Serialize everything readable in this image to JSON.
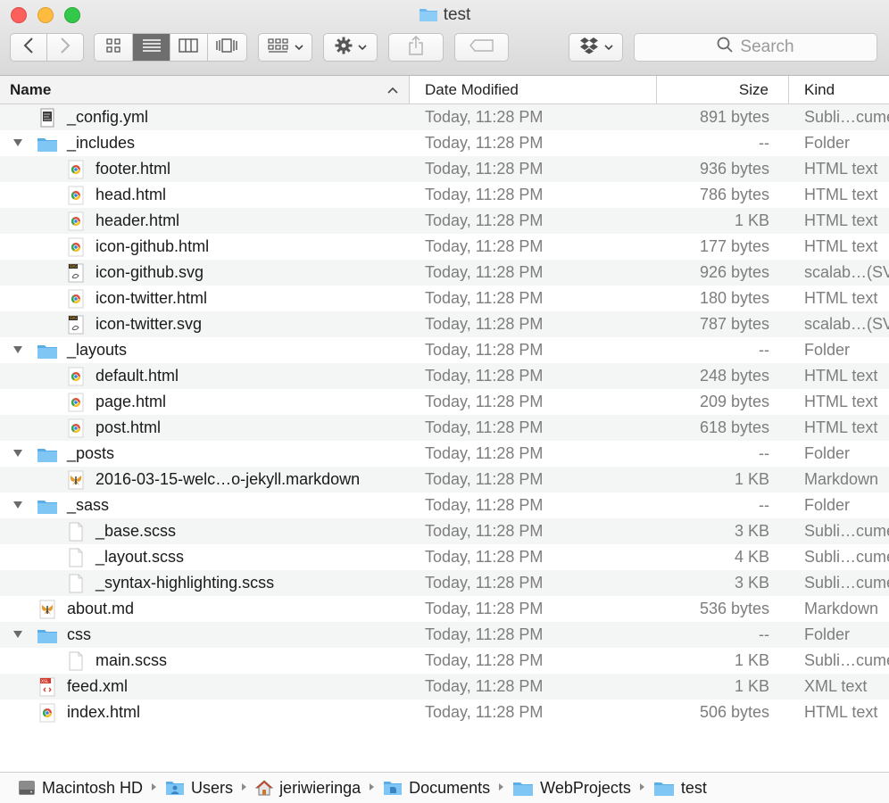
{
  "window": {
    "title": "test"
  },
  "toolbar": {
    "search_placeholder": "Search",
    "back_icon": "chevron-left-icon",
    "forward_icon": "chevron-right-icon"
  },
  "columns": {
    "name": "Name",
    "date": "Date Modified",
    "size": "Size",
    "kind": "Kind"
  },
  "rows": [
    {
      "name": "_config.yml",
      "date": "Today, 11:28 PM",
      "size": "891 bytes",
      "kind": "Subli…cument",
      "icon": "yml-file-icon",
      "level": 0,
      "folder": false
    },
    {
      "name": "_includes",
      "date": "Today, 11:28 PM",
      "size": "--",
      "kind": "Folder",
      "icon": "folder-icon",
      "level": 0,
      "folder": true
    },
    {
      "name": "footer.html",
      "date": "Today, 11:28 PM",
      "size": "936 bytes",
      "kind": "HTML text",
      "icon": "chrome-html-icon",
      "level": 1,
      "folder": false
    },
    {
      "name": "head.html",
      "date": "Today, 11:28 PM",
      "size": "786 bytes",
      "kind": "HTML text",
      "icon": "chrome-html-icon",
      "level": 1,
      "folder": false
    },
    {
      "name": "header.html",
      "date": "Today, 11:28 PM",
      "size": "1 KB",
      "kind": "HTML text",
      "icon": "chrome-html-icon",
      "level": 1,
      "folder": false
    },
    {
      "name": "icon-github.html",
      "date": "Today, 11:28 PM",
      "size": "177 bytes",
      "kind": "HTML text",
      "icon": "chrome-html-icon",
      "level": 1,
      "folder": false
    },
    {
      "name": "icon-github.svg",
      "date": "Today, 11:28 PM",
      "size": "926 bytes",
      "kind": "scalab…(SVG)",
      "icon": "svg-file-icon",
      "level": 1,
      "folder": false
    },
    {
      "name": "icon-twitter.html",
      "date": "Today, 11:28 PM",
      "size": "180 bytes",
      "kind": "HTML text",
      "icon": "chrome-html-icon",
      "level": 1,
      "folder": false
    },
    {
      "name": "icon-twitter.svg",
      "date": "Today, 11:28 PM",
      "size": "787 bytes",
      "kind": "scalab…(SVG)",
      "icon": "svg-file-icon",
      "level": 1,
      "folder": false
    },
    {
      "name": "_layouts",
      "date": "Today, 11:28 PM",
      "size": "--",
      "kind": "Folder",
      "icon": "folder-icon",
      "level": 0,
      "folder": true
    },
    {
      "name": "default.html",
      "date": "Today, 11:28 PM",
      "size": "248 bytes",
      "kind": "HTML text",
      "icon": "chrome-html-icon",
      "level": 1,
      "folder": false
    },
    {
      "name": "page.html",
      "date": "Today, 11:28 PM",
      "size": "209 bytes",
      "kind": "HTML text",
      "icon": "chrome-html-icon",
      "level": 1,
      "folder": false
    },
    {
      "name": "post.html",
      "date": "Today, 11:28 PM",
      "size": "618 bytes",
      "kind": "HTML text",
      "icon": "chrome-html-icon",
      "level": 1,
      "folder": false
    },
    {
      "name": "_posts",
      "date": "Today, 11:28 PM",
      "size": "--",
      "kind": "Folder",
      "icon": "folder-icon",
      "level": 0,
      "folder": true
    },
    {
      "name": "2016-03-15-welc…o-jekyll.markdown",
      "date": "Today, 11:28 PM",
      "size": "1 KB",
      "kind": "Markdown",
      "icon": "markdown-file-icon",
      "level": 1,
      "folder": false
    },
    {
      "name": "_sass",
      "date": "Today, 11:28 PM",
      "size": "--",
      "kind": "Folder",
      "icon": "folder-icon",
      "level": 0,
      "folder": true
    },
    {
      "name": "_base.scss",
      "date": "Today, 11:28 PM",
      "size": "3 KB",
      "kind": "Subli…cument",
      "icon": "blank-file-icon",
      "level": 1,
      "folder": false
    },
    {
      "name": "_layout.scss",
      "date": "Today, 11:28 PM",
      "size": "4 KB",
      "kind": "Subli…cument",
      "icon": "blank-file-icon",
      "level": 1,
      "folder": false
    },
    {
      "name": "_syntax-highlighting.scss",
      "date": "Today, 11:28 PM",
      "size": "3 KB",
      "kind": "Subli…cument",
      "icon": "blank-file-icon",
      "level": 1,
      "folder": false
    },
    {
      "name": "about.md",
      "date": "Today, 11:28 PM",
      "size": "536 bytes",
      "kind": "Markdown",
      "icon": "markdown-file-icon",
      "level": 0,
      "folder": false
    },
    {
      "name": "css",
      "date": "Today, 11:28 PM",
      "size": "--",
      "kind": "Folder",
      "icon": "folder-icon",
      "level": 0,
      "folder": true
    },
    {
      "name": "main.scss",
      "date": "Today, 11:28 PM",
      "size": "1 KB",
      "kind": "Subli…cument",
      "icon": "blank-file-icon",
      "level": 1,
      "folder": false
    },
    {
      "name": "feed.xml",
      "date": "Today, 11:28 PM",
      "size": "1 KB",
      "kind": "XML text",
      "icon": "xml-file-icon",
      "level": 0,
      "folder": false
    },
    {
      "name": "index.html",
      "date": "Today, 11:28 PM",
      "size": "506 bytes",
      "kind": "HTML text",
      "icon": "chrome-html-icon",
      "level": 0,
      "folder": false
    }
  ],
  "pathbar": [
    {
      "label": "Macintosh HD",
      "icon": "hard-drive-icon"
    },
    {
      "label": "Users",
      "icon": "users-folder-icon"
    },
    {
      "label": "jeriwieringa",
      "icon": "home-icon"
    },
    {
      "label": "Documents",
      "icon": "documents-folder-icon"
    },
    {
      "label": "WebProjects",
      "icon": "folder-icon"
    },
    {
      "label": "test",
      "icon": "folder-icon"
    }
  ],
  "colors": {
    "folder_blue": "#6cb8f0",
    "row_alt": "#f4f5f5",
    "secondary_text": "#7d7d7d"
  }
}
